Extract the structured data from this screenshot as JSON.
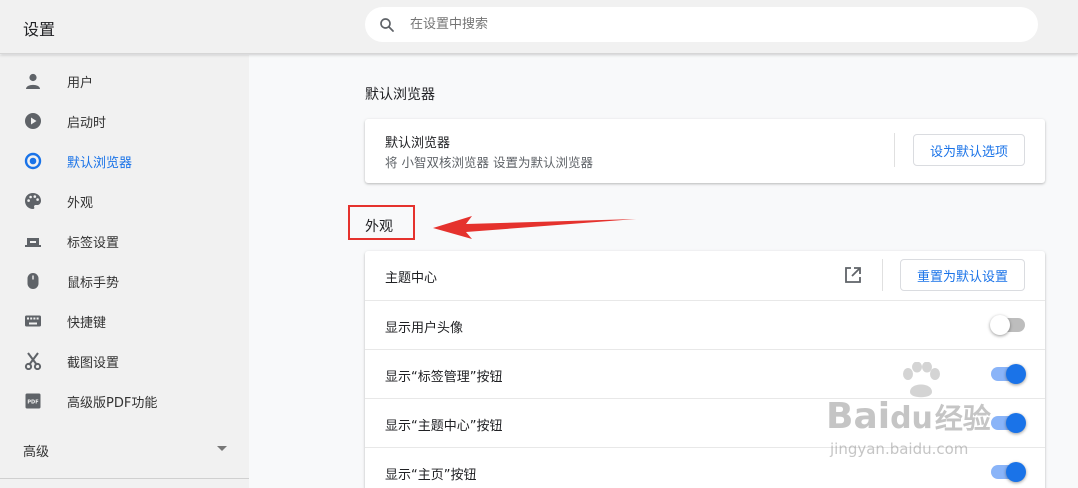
{
  "header": {
    "title": "设置",
    "search_placeholder": "在设置中搜索"
  },
  "sidebar": {
    "items": [
      {
        "label": "用户",
        "icon": "person-icon"
      },
      {
        "label": "启动时",
        "icon": "power-icon"
      },
      {
        "label": "默认浏览器",
        "icon": "browser-icon",
        "active": true
      },
      {
        "label": "外观",
        "icon": "palette-icon"
      },
      {
        "label": "标签设置",
        "icon": "tab-icon"
      },
      {
        "label": "鼠标手势",
        "icon": "mouse-icon"
      },
      {
        "label": "快捷键",
        "icon": "keyboard-icon"
      },
      {
        "label": "截图设置",
        "icon": "scissors-icon"
      },
      {
        "label": "高级版PDF功能",
        "icon": "pdf-icon"
      }
    ],
    "advanced_label": "高级"
  },
  "default_browser": {
    "section_title": "默认浏览器",
    "card_title": "默认浏览器",
    "card_subtitle": "将 小智双核浏览器 设置为默认浏览器",
    "button_label": "设为默认选项"
  },
  "appearance": {
    "section_title": "外观",
    "theme_center_label": "主题中心",
    "reset_button_label": "重置为默认设置",
    "toggles": [
      {
        "label": "显示用户头像",
        "on": false
      },
      {
        "label": "显示“标签管理”按钮",
        "on": true
      },
      {
        "label": "显示“主题中心”按钮",
        "on": true
      },
      {
        "label": "显示“主页”按钮",
        "on": true
      }
    ]
  },
  "watermark": {
    "line1": "Bai",
    "line2": "du",
    "line3": "经验",
    "url": "jingyan.baidu.com"
  },
  "colors": {
    "accent": "#1a73e8",
    "annotation_red": "#e5322d"
  }
}
